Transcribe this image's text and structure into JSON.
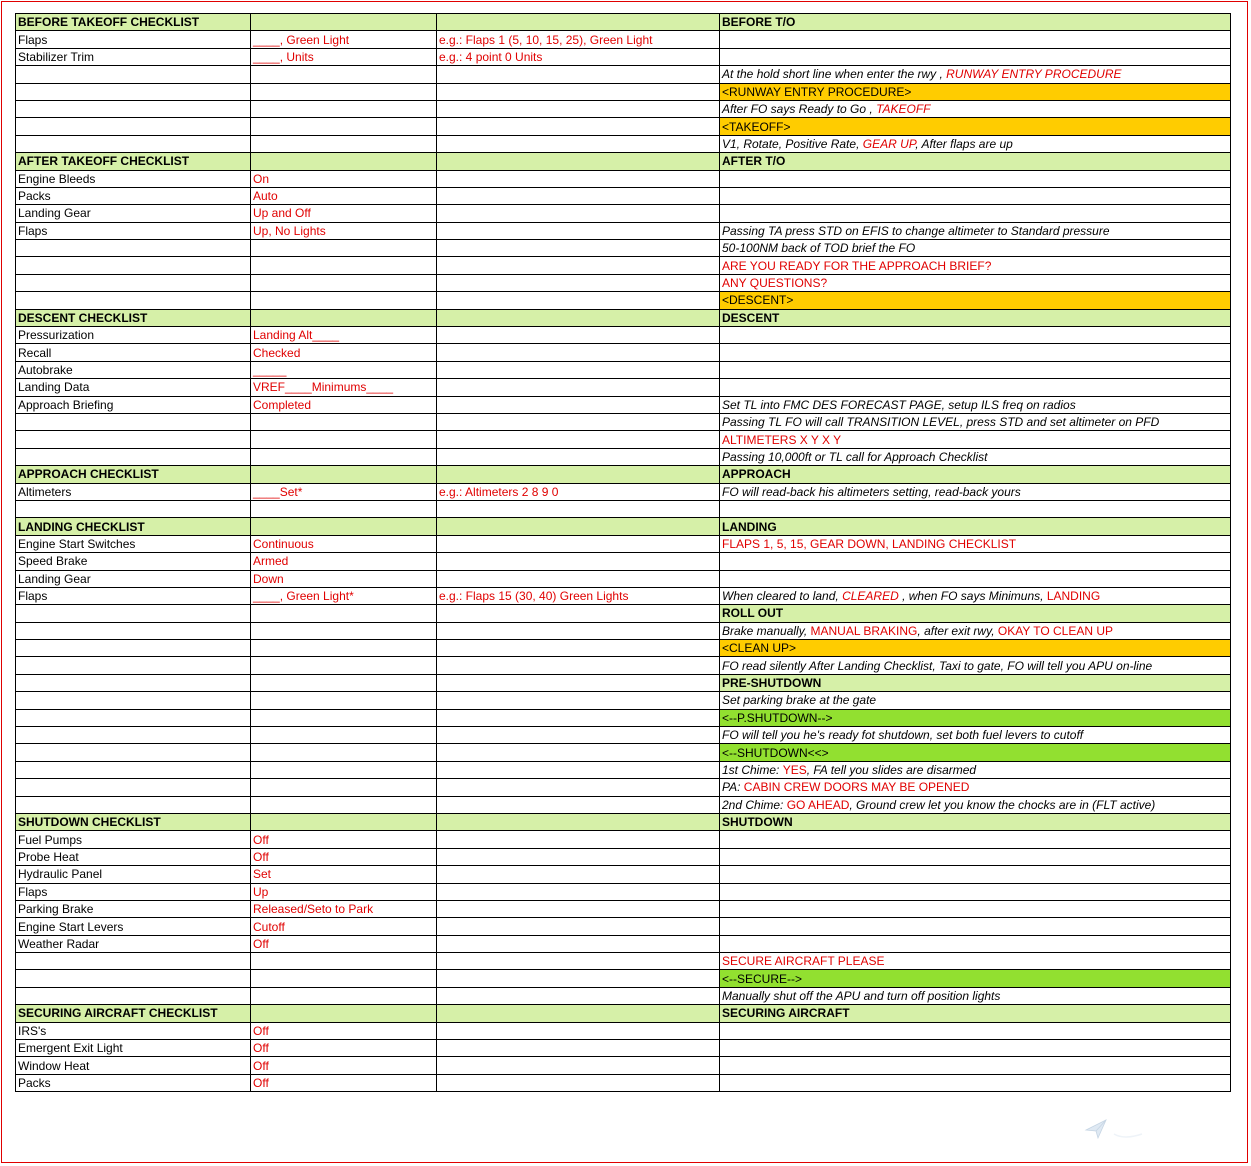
{
  "rows": [
    {
      "c0": "BEFORE TAKEOFF CHECKLIST",
      "c1": "",
      "c2": "",
      "c3": [
        {
          "t": "BEFORE T/O"
        }
      ],
      "type": "hdr"
    },
    {
      "c0": "Flaps",
      "c1": "____, Green Light",
      "c2": "e.g.: Flaps 1 (5, 10, 15, 25), Green Light",
      "c3": []
    },
    {
      "c0": "Stabilizer Trim",
      "c1": "____, Units",
      "c2": "e.g.: 4 point 0 Units",
      "c3": []
    },
    {
      "c0": "",
      "c1": "",
      "c2": "",
      "c3": [
        {
          "t": "At the hold short line when enter the rwy , "
        },
        {
          "t": "RUNWAY ENTRY PROCEDURE",
          "r": 1
        }
      ],
      "it": 1
    },
    {
      "c0": "",
      "c1": "",
      "c2": "",
      "c3": [
        {
          "t": "<RUNWAY ENTRY PROCEDURE>"
        }
      ],
      "bg": "or"
    },
    {
      "c0": "",
      "c1": "",
      "c2": "",
      "c3": [
        {
          "t": "After FO says Ready to Go , "
        },
        {
          "t": "TAKEOFF",
          "r": 1
        }
      ],
      "it": 1
    },
    {
      "c0": "",
      "c1": "",
      "c2": "",
      "c3": [
        {
          "t": "<TAKEOFF>"
        }
      ],
      "bg": "or"
    },
    {
      "c0": "",
      "c1": "",
      "c2": "",
      "c3": [
        {
          "t": "V1, Rotate, Positive Rate,  "
        },
        {
          "t": "GEAR UP",
          "r": 1
        },
        {
          "t": ", After flaps are up"
        }
      ],
      "it": 1
    },
    {
      "c0": "AFTER TAKEOFF CHECKLIST",
      "c1": "",
      "c2": "",
      "c3": [
        {
          "t": "AFTER T/O"
        }
      ],
      "type": "hdr"
    },
    {
      "c0": "Engine Bleeds",
      "c1": "On",
      "c2": "",
      "c3": []
    },
    {
      "c0": "Packs",
      "c1": "Auto",
      "c2": "",
      "c3": []
    },
    {
      "c0": "Landing Gear",
      "c1": "Up and Off",
      "c2": "",
      "c3": []
    },
    {
      "c0": "Flaps",
      "c1": "Up, No Lights",
      "c2": "",
      "c3": [
        {
          "t": "Passing TA press STD on EFIS to change altimeter to Standard pressure"
        }
      ],
      "it": 1
    },
    {
      "c0": "",
      "c1": "",
      "c2": "",
      "c3": [
        {
          "t": "50-100NM back of TOD brief the FO"
        }
      ],
      "it": 1
    },
    {
      "c0": "",
      "c1": "",
      "c2": "",
      "c3": [
        {
          "t": "ARE YOU READY FOR THE APPROACH BRIEF?",
          "r": 1
        }
      ]
    },
    {
      "c0": "",
      "c1": "",
      "c2": "",
      "c3": [
        {
          "t": "ANY QUESTIONS?",
          "r": 1
        }
      ]
    },
    {
      "c0": "",
      "c1": "",
      "c2": "",
      "c3": [
        {
          "t": "<DESCENT>"
        }
      ],
      "bg": "or"
    },
    {
      "c0": "DESCENT CHECKLIST",
      "c1": "",
      "c2": "",
      "c3": [
        {
          "t": "DESCENT"
        }
      ],
      "type": "hdr"
    },
    {
      "c0": "Pressurization",
      "c1": "Landing Alt____",
      "c2": "",
      "c3": []
    },
    {
      "c0": "Recall",
      "c1": "Checked",
      "c2": "",
      "c3": []
    },
    {
      "c0": "Autobrake",
      "c1": "_____",
      "c2": "",
      "c3": []
    },
    {
      "c0": "Landing Data",
      "c1": "VREF____Minimums____",
      "c2": "",
      "c3": []
    },
    {
      "c0": "Approach Briefing",
      "c1": "Completed",
      "c2": "",
      "c3": [
        {
          "t": "Set TL into FMC DES FORECAST PAGE, setup ILS freq on radios"
        }
      ],
      "it": 1
    },
    {
      "c0": "",
      "c1": "",
      "c2": "",
      "c3": [
        {
          "t": "Passing TL FO will call TRANSITION LEVEL, press STD and set altimeter on PFD"
        }
      ],
      "it": 1
    },
    {
      "c0": "",
      "c1": "",
      "c2": "",
      "c3": [
        {
          "t": "ALTIMETERS X Y X Y",
          "r": 1
        }
      ]
    },
    {
      "c0": "",
      "c1": "",
      "c2": "",
      "c3": [
        {
          "t": "Passing 10,000ft or TL call for Approach Checklist"
        }
      ],
      "it": 1
    },
    {
      "c0": "APPROACH CHECKLIST",
      "c1": "",
      "c2": "",
      "c3": [
        {
          "t": "APPROACH"
        }
      ],
      "type": "hdr"
    },
    {
      "c0": "Altimeters",
      "c1": "____Set*",
      "c2": "e.g.: Altimeters 2 8 9 0",
      "c3": [
        {
          "t": "FO will read-back his altimeters setting, read-back yours"
        }
      ],
      "it": 1
    },
    {
      "c0": "",
      "c1": "",
      "c2": "",
      "c3": []
    },
    {
      "c0": "LANDING CHECKLIST",
      "c1": "",
      "c2": "",
      "c3": [
        {
          "t": "LANDING"
        }
      ],
      "type": "hdr"
    },
    {
      "c0": "Engine Start Switches",
      "c1": "Continuous",
      "c2": "",
      "c3": [
        {
          "t": "FLAPS 1, 5, 15, GEAR DOWN, LANDING CHECKLIST",
          "r": 1
        }
      ]
    },
    {
      "c0": "Speed Brake",
      "c1": "Armed",
      "c2": "",
      "c3": []
    },
    {
      "c0": "Landing Gear",
      "c1": "Down",
      "c2": "",
      "c3": []
    },
    {
      "c0": "Flaps",
      "c1": "____, Green Light*",
      "c2": "e.g.: Flaps 15 (30, 40) Green Lights",
      "c3": [
        {
          "t": "When cleared to land,  "
        },
        {
          "t": "CLEARED",
          "r": 1
        },
        {
          "t": " , when FO says Minimuns,  "
        },
        {
          "t": "LANDING",
          "r": 1,
          "n": 1
        }
      ],
      "it": 1
    },
    {
      "c0": "",
      "c1": "",
      "c2": "",
      "c3": [
        {
          "t": "ROLL OUT"
        }
      ],
      "bg": "lg",
      "b": 1
    },
    {
      "c0": "",
      "c1": "",
      "c2": "",
      "c3": [
        {
          "t": "Brake manually,  "
        },
        {
          "t": "MANUAL BRAKING",
          "r": 1,
          "n": 1
        },
        {
          "t": ", after exit rwy,  "
        },
        {
          "t": "OKAY TO CLEAN UP",
          "r": 1,
          "n": 1
        }
      ],
      "it": 1
    },
    {
      "c0": "",
      "c1": "",
      "c2": "",
      "c3": [
        {
          "t": "<CLEAN UP>"
        }
      ],
      "bg": "or"
    },
    {
      "c0": "",
      "c1": "",
      "c2": "",
      "c3": [
        {
          "t": "FO read silently After Landing Checklist, Taxi to gate, FO will tell you APU on-line"
        }
      ],
      "it": 1
    },
    {
      "c0": "",
      "c1": "",
      "c2": "",
      "c3": [
        {
          "t": "PRE-SHUTDOWN"
        }
      ],
      "bg": "lg",
      "b": 1
    },
    {
      "c0": "",
      "c1": "",
      "c2": "",
      "c3": [
        {
          "t": "Set parking brake at the gate"
        }
      ],
      "it": 1
    },
    {
      "c0": "",
      "c1": "",
      "c2": "",
      "c3": [
        {
          "t": "<--P.SHUTDOWN-->"
        }
      ],
      "bg": "gr"
    },
    {
      "c0": "",
      "c1": "",
      "c2": "",
      "c3": [
        {
          "t": "FO will tell you he's ready fot shutdown, set both fuel levers to cutoff"
        }
      ],
      "it": 1
    },
    {
      "c0": "",
      "c1": "",
      "c2": "",
      "c3": [
        {
          "t": "<--SHUTDOWN<<>"
        }
      ],
      "bg": "gr"
    },
    {
      "c0": "",
      "c1": "",
      "c2": "",
      "c3": [
        {
          "t": "1st Chime:  "
        },
        {
          "t": "YES",
          "r": 1,
          "n": 1
        },
        {
          "t": ", FA tell you slides are disarmed"
        }
      ],
      "it": 1
    },
    {
      "c0": "",
      "c1": "",
      "c2": "",
      "c3": [
        {
          "t": "PA:  "
        },
        {
          "t": "CABIN CREW DOORS MAY BE OPENED",
          "r": 1,
          "n": 1
        }
      ],
      "it": 1
    },
    {
      "c0": "",
      "c1": "",
      "c2": "",
      "c3": [
        {
          "t": "2nd Chime:  "
        },
        {
          "t": "GO AHEAD",
          "r": 1,
          "n": 1
        },
        {
          "t": ", Ground crew let you know the chocks are in (FLT active)"
        }
      ],
      "it": 1
    },
    {
      "c0": "SHUTDOWN CHECKLIST",
      "c1": "",
      "c2": "",
      "c3": [
        {
          "t": "SHUTDOWN"
        }
      ],
      "type": "hdr"
    },
    {
      "c0": "Fuel Pumps",
      "c1": "Off",
      "c2": "",
      "c3": []
    },
    {
      "c0": "Probe Heat",
      "c1": "Off",
      "c2": "",
      "c3": []
    },
    {
      "c0": "Hydraulic Panel",
      "c1": "Set",
      "c2": "",
      "c3": []
    },
    {
      "c0": "Flaps",
      "c1": "Up",
      "c2": "",
      "c3": []
    },
    {
      "c0": "Parking Brake",
      "c1": "Released/Seto to Park",
      "c2": "",
      "c3": []
    },
    {
      "c0": "Engine Start Levers",
      "c1": "Cutoff",
      "c2": "",
      "c3": []
    },
    {
      "c0": "Weather Radar",
      "c1": "Off",
      "c2": "",
      "c3": []
    },
    {
      "c0": "",
      "c1": "",
      "c2": "",
      "c3": [
        {
          "t": "SECURE AIRCRAFT PLEASE",
          "r": 1
        }
      ]
    },
    {
      "c0": "",
      "c1": "",
      "c2": "",
      "c3": [
        {
          "t": "<--SECURE-->"
        }
      ],
      "bg": "gr"
    },
    {
      "c0": "",
      "c1": "",
      "c2": "",
      "c3": [
        {
          "t": "Manually shut off the APU and turn off position lights"
        }
      ],
      "it": 1
    },
    {
      "c0": "SECURING AIRCRAFT CHECKLIST",
      "c1": "",
      "c2": "",
      "c3": [
        {
          "t": "SECURING AIRCRAFT"
        }
      ],
      "type": "hdr"
    },
    {
      "c0": "IRS's",
      "c1": "Off",
      "c2": "",
      "c3": []
    },
    {
      "c0": "Emergent Exit Light",
      "c1": "Off",
      "c2": "",
      "c3": []
    },
    {
      "c0": "Window Heat",
      "c1": "Off",
      "c2": "",
      "c3": []
    },
    {
      "c0": "Packs",
      "c1": "Off",
      "c2": "",
      "c3": []
    }
  ],
  "colors": {
    "header_bg": "#d6f0a8",
    "orange_bg": "#ffcc00",
    "green_bg": "#92e030",
    "red_text": "#e00000"
  }
}
